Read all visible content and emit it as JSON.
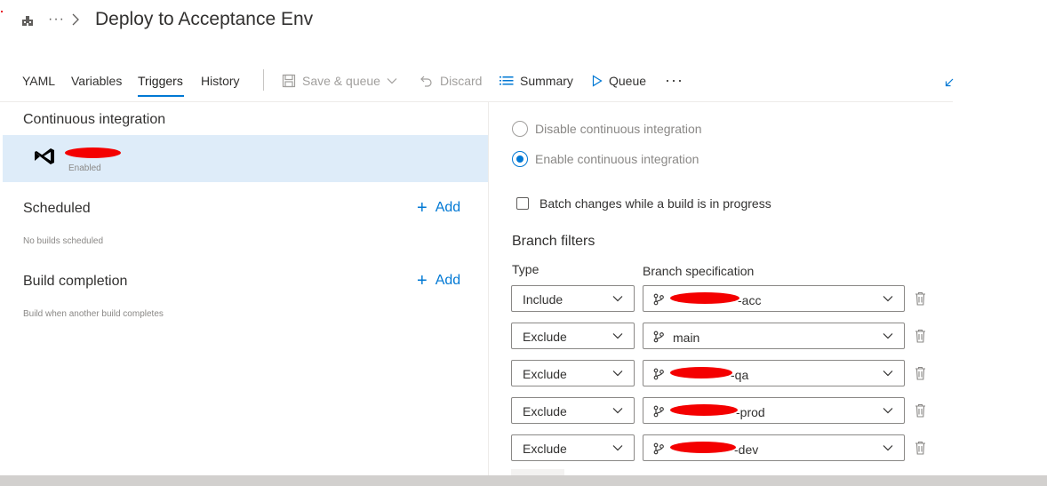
{
  "header": {
    "breadcrumb_ellipsis": "···",
    "title": "Deploy to Acceptance Env"
  },
  "tabs": [
    {
      "label": "YAML"
    },
    {
      "label": "Variables"
    },
    {
      "label": "Triggers",
      "active": true
    },
    {
      "label": "History"
    }
  ],
  "toolbar": {
    "save_queue": "Save & queue",
    "discard": "Discard",
    "summary": "Summary",
    "queue": "Queue",
    "more": "···"
  },
  "left": {
    "ci_title": "Continuous integration",
    "ci_item_status": "Enabled",
    "scheduled_title": "Scheduled",
    "scheduled_add": "Add",
    "scheduled_desc": "No builds scheduled",
    "completion_title": "Build completion",
    "completion_add": "Add",
    "completion_desc": "Build when another build completes"
  },
  "right": {
    "disable_ci": "Disable continuous integration",
    "enable_ci": "Enable continuous integration",
    "batch": "Batch changes while a build is in progress",
    "branch_filters_title": "Branch filters",
    "type_header": "Type",
    "spec_header": "Branch specification",
    "filters": [
      {
        "type": "Include",
        "spec": "-acc"
      },
      {
        "type": "Exclude",
        "spec": "main"
      },
      {
        "type": "Exclude",
        "spec": "-qa"
      },
      {
        "type": "Exclude",
        "spec": "-prod"
      },
      {
        "type": "Exclude",
        "spec": "-dev"
      }
    ]
  },
  "colors": {
    "accent": "#0078d4",
    "selected_row": "#deecf9",
    "redaction": "#f40000"
  }
}
